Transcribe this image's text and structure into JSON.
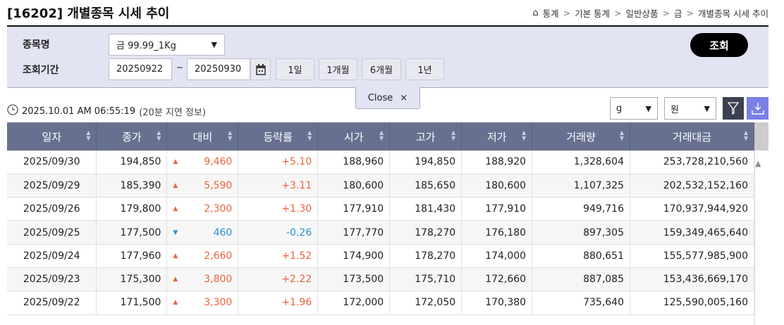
{
  "title": "[16202] 개별종목 시세 추이",
  "breadcrumb": [
    "통계",
    "기본 통계",
    "일반상품",
    "금",
    "개별종목 시세 추이"
  ],
  "filter": {
    "item_label": "종목명",
    "item_value": "금 99.99_1Kg",
    "period_label": "조회기간",
    "start": "20250922",
    "tilde": "~",
    "end": "20250930",
    "periods": [
      "1일",
      "1개월",
      "6개월",
      "1년"
    ],
    "search": "조회",
    "close": "Close",
    "close_x": "×"
  },
  "timestamp": "2025.10.01 AM 06:55:19",
  "delay": "(20분 지연 정보)",
  "unit": "g",
  "currency": "원",
  "columns": [
    "일자",
    "종가",
    "대비",
    "등락률",
    "시가",
    "고가",
    "저가",
    "거래량",
    "거래대금"
  ],
  "rows": [
    [
      "2025/09/30",
      "194,850",
      "up",
      "9,460",
      "+5.10",
      "188,960",
      "194,850",
      "188,920",
      "1,328,604",
      "253,728,210,560"
    ],
    [
      "2025/09/29",
      "185,390",
      "up",
      "5,590",
      "+3.11",
      "180,600",
      "185,650",
      "180,600",
      "1,107,325",
      "202,532,152,160"
    ],
    [
      "2025/09/26",
      "179,800",
      "up",
      "2,300",
      "+1.30",
      "177,910",
      "181,430",
      "177,910",
      "949,716",
      "170,937,944,920"
    ],
    [
      "2025/09/25",
      "177,500",
      "dn",
      "460",
      "-0.26",
      "177,770",
      "178,270",
      "176,180",
      "897,305",
      "159,349,465,640"
    ],
    [
      "2025/09/24",
      "177,960",
      "up",
      "2,660",
      "+1.52",
      "174,900",
      "178,270",
      "174,000",
      "880,651",
      "155,577,985,900"
    ],
    [
      "2025/09/23",
      "175,300",
      "up",
      "3,800",
      "+2.22",
      "173,500",
      "175,710",
      "172,660",
      "887,085",
      "153,436,669,170"
    ],
    [
      "2025/09/22",
      "171,500",
      "up",
      "3,300",
      "+1.96",
      "172,000",
      "172,050",
      "170,380",
      "735,640",
      "125,590,005,160"
    ]
  ],
  "colors": {
    "up": "#e8643c",
    "down": "#2a8fd0",
    "header": "#67718f"
  }
}
